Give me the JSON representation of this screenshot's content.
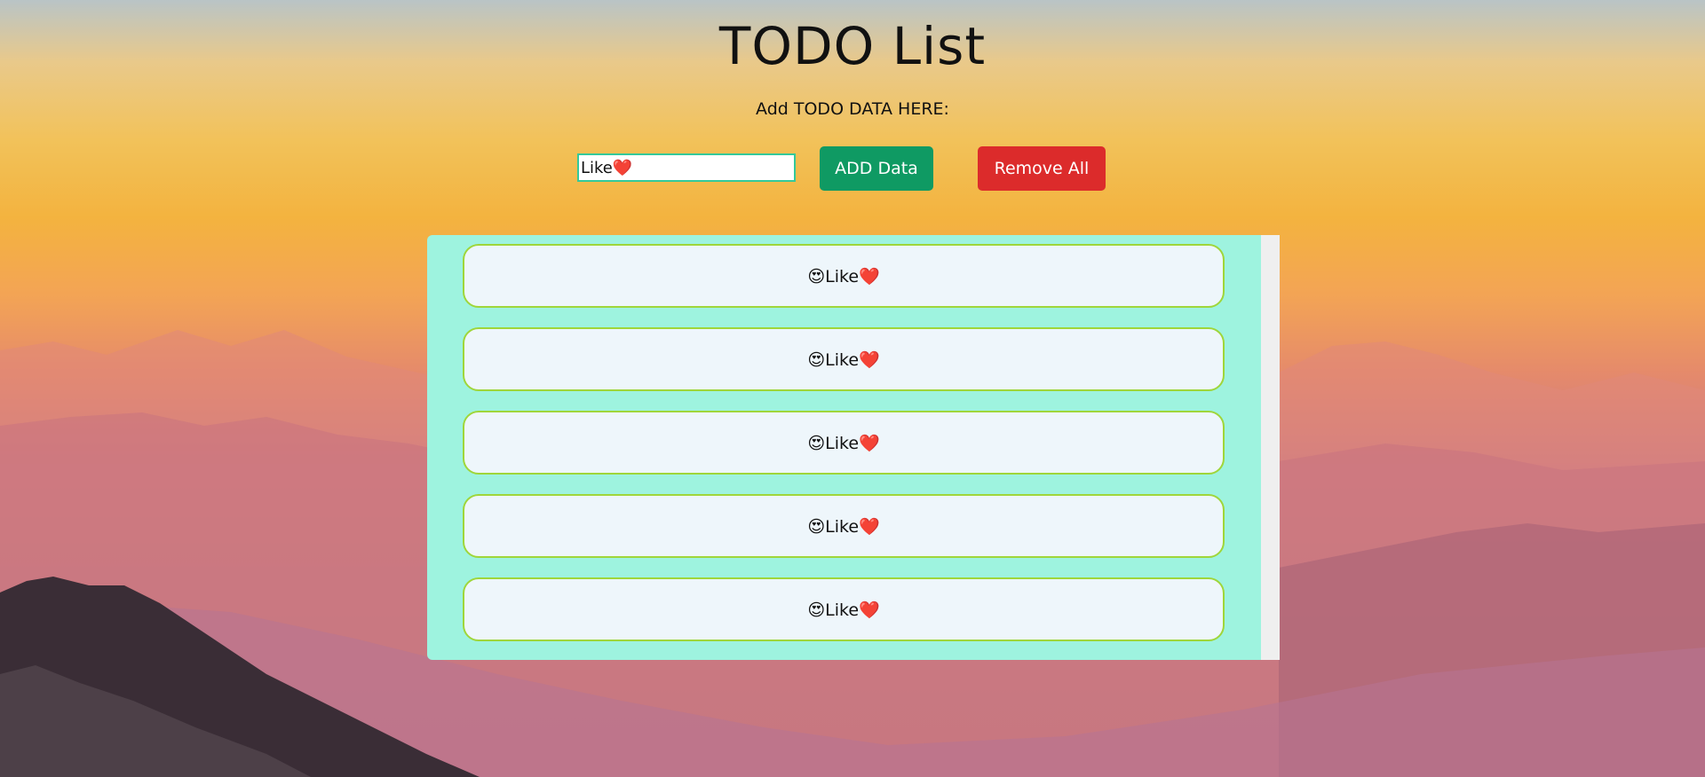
{
  "header": {
    "title": "TODO List",
    "subtitle": "Add TODO DATA HERE:"
  },
  "form": {
    "input_value": "Like❤️",
    "add_label": "ADD Data",
    "remove_label": "Remove All"
  },
  "todos": [
    {
      "text": "😍Like❤️"
    },
    {
      "text": "😍Like❤️"
    },
    {
      "text": "😍Like❤️"
    },
    {
      "text": "😍Like❤️"
    },
    {
      "text": "😍Like❤️"
    }
  ],
  "colors": {
    "add_button": "#0f9a63",
    "remove_button": "#dc2b2b",
    "panel": "#9ef3df",
    "item_border": "#9fd63a"
  }
}
